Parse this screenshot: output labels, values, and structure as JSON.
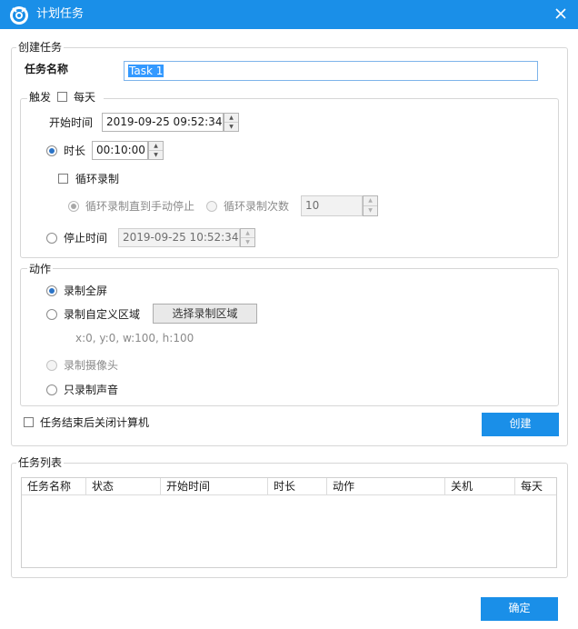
{
  "window": {
    "title": "计划任务",
    "app_icon": "app-logo-icon",
    "close_icon": "close-icon"
  },
  "create": {
    "group_title": "创建任务",
    "task_name_label": "任务名称",
    "task_name_value": "Task 1",
    "trigger": {
      "group_title": "触发",
      "daily_label": "每天",
      "daily_checked": false,
      "start_label": "开始时间",
      "start_value": "2019-09-25 09:52:34",
      "duration_label": "时长",
      "duration_value": "00:10:00",
      "duration_selected": true,
      "loop_label": "循环录制",
      "loop_checked": false,
      "loop_until_stop_label": "循环录制直到手动停止",
      "loop_count_label": "循环录制次数",
      "loop_count_value": "10",
      "stop_label": "停止时间",
      "stop_value": "2019-09-25 10:52:34",
      "stop_selected": false
    },
    "action": {
      "group_title": "动作",
      "fullscreen_label": "录制全屏",
      "fullscreen_selected": true,
      "custom_area_label": "录制自定义区域",
      "select_area_button": "选择录制区域",
      "area_info": "x:0, y:0, w:100, h:100",
      "camera_label": "录制摄像头",
      "audio_only_label": "只录制声音"
    },
    "shutdown_label": "任务结束后关闭计算机",
    "shutdown_checked": false,
    "create_button": "创建"
  },
  "task_list": {
    "group_title": "任务列表",
    "columns": [
      "任务名称",
      "状态",
      "开始时间",
      "时长",
      "动作",
      "关机",
      "每天"
    ],
    "rows": []
  },
  "ok_button": "确定",
  "colors": {
    "accent": "#1a8fe8",
    "selection": "#3399ff",
    "radio_dot": "#2b74c7"
  }
}
